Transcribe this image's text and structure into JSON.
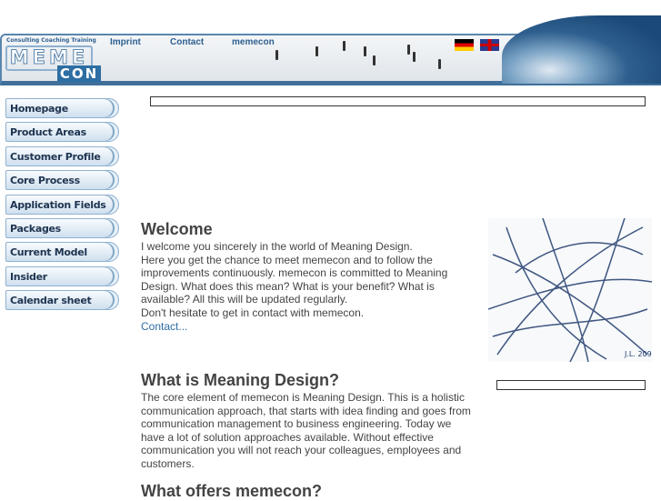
{
  "logo": {
    "tagline": "Consulting  Coaching  Training",
    "top": "MEME",
    "bottom": "CON"
  },
  "header": {
    "links": [
      "Imprint",
      "Contact",
      "memecon"
    ],
    "flags": [
      "german-flag",
      "uk-flag"
    ]
  },
  "nav": [
    "Homepage",
    "Product Areas",
    "Customer Profile",
    "Core Process",
    "Application Fields",
    "Packages",
    "Current Model",
    "Insider",
    "Calendar sheet"
  ],
  "welcome": {
    "title": "Welcome",
    "lines": [
      "I welcome you sincerely in the world of Meaning Design.",
      "Here you get the chance to meet memecon and to follow the improvements continuously. memecon is committed to Meaning Design. What does this mean? What is your benefit? What is available? All this will be updated regularly.",
      "Don't hesitate to get in contact with memecon."
    ],
    "link": "Contact..."
  },
  "meaning": {
    "title": "What is Meaning Design?",
    "text": "The core element of memecon is Meaning Design. This is a holistic communication approach, that starts with idea finding and goes from communication management to business engineering. Today we have a lot of solution approaches available. Without effective communication you will not reach your colleagues, employees and customers."
  },
  "offers": {
    "title": "What offers memecon?"
  },
  "sketch": {
    "signature": "J.L. 209"
  }
}
